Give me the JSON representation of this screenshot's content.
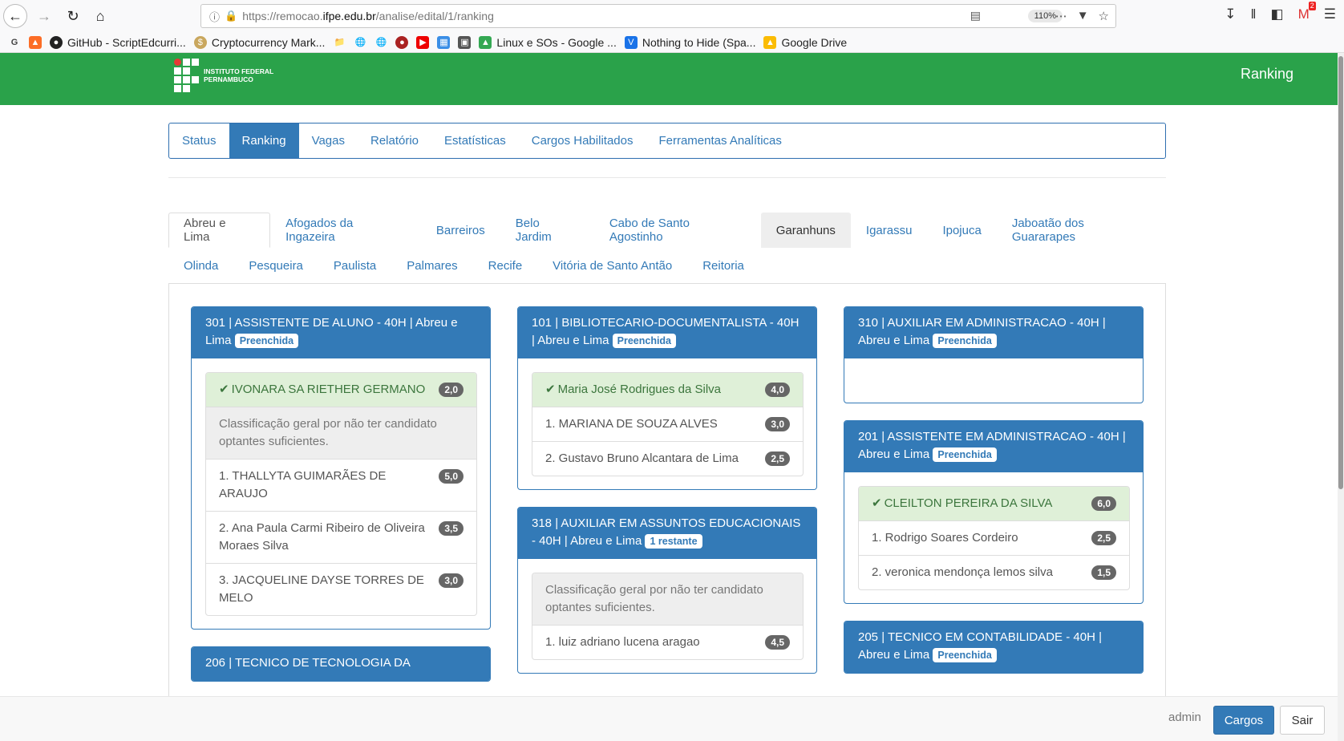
{
  "browser": {
    "url_prefix": "https://remocao.",
    "url_domain": "ifpe.edu.br",
    "url_path": "/analise/edital/1/ranking",
    "zoom": "110%",
    "notification_count": "2"
  },
  "bookmarks": [
    {
      "label": "GitHub - ScriptEdcurri..."
    },
    {
      "label": "Cryptocurrency Mark..."
    },
    {
      "label": "Linux e SOs - Google ..."
    },
    {
      "label": "Nothing to Hide (Spa..."
    },
    {
      "label": "Google Drive"
    }
  ],
  "header": {
    "logo_line1": "INSTITUTO FEDERAL",
    "logo_line2": "PERNAMBUCO",
    "title": "Ranking"
  },
  "main_nav": [
    "Status",
    "Ranking",
    "Vagas",
    "Relatório",
    "Estatísticas",
    "Cargos Habilitados",
    "Ferramentas Analíticas"
  ],
  "campus_tabs_row1": [
    "Abreu e Lima",
    "Afogados da Ingazeira",
    "Barreiros",
    "Belo Jardim",
    "Cabo de Santo Agostinho",
    "Garanhuns",
    "Igarassu",
    "Ipojuca",
    "Jaboatão dos Guararapes"
  ],
  "campus_tabs_row2": [
    "Olinda",
    "Pesqueira",
    "Paulista",
    "Palmares",
    "Recife",
    "Vitória de Santo Antão",
    "Reitoria"
  ],
  "panels": {
    "p301": {
      "title": "301 | ASSISTENTE DE ALUNO - 40H | Abreu e Lima",
      "badge": "Preenchida",
      "winner": "IVONARA SA RIETHER GERMANO",
      "winner_score": "2,0",
      "note": "Classificação geral por não ter candidato optantes suficientes.",
      "items": [
        {
          "name": "1. THALLYTA GUIMARÃES DE ARAUJO",
          "score": "5,0"
        },
        {
          "name": "2. Ana Paula Carmi Ribeiro de Oliveira Moraes Silva",
          "score": "3,5"
        },
        {
          "name": "3. JACQUELINE DAYSE TORRES DE MELO",
          "score": "3,0"
        }
      ]
    },
    "p206": {
      "title": "206 | TECNICO DE TECNOLOGIA DA"
    },
    "p101": {
      "title": "101 | BIBLIOTECARIO-DOCUMENTALISTA - 40H | Abreu e Lima",
      "badge": "Preenchida",
      "winner": "Maria José Rodrigues da Silva",
      "winner_score": "4,0",
      "items": [
        {
          "name": "1. MARIANA DE SOUZA ALVES",
          "score": "3,0"
        },
        {
          "name": "2. Gustavo Bruno Alcantara de Lima",
          "score": "2,5"
        }
      ]
    },
    "p318": {
      "title": "318 | AUXILIAR EM ASSUNTOS EDUCACIONAIS - 40H | Abreu e Lima",
      "badge": "1 restante",
      "note": "Classificação geral por não ter candidato optantes suficientes.",
      "items": [
        {
          "name": "1. luiz adriano lucena aragao",
          "score": "4,5"
        }
      ]
    },
    "p310": {
      "title": "310 | AUXILIAR EM ADMINISTRACAO - 40H | Abreu e Lima",
      "badge": "Preenchida"
    },
    "p201": {
      "title": "201 | ASSISTENTE EM ADMINISTRACAO - 40H | Abreu e Lima",
      "badge": "Preenchida",
      "winner": "CLEILTON PEREIRA DA SILVA",
      "winner_score": "6,0",
      "items": [
        {
          "name": "1. Rodrigo Soares Cordeiro",
          "score": "2,5"
        },
        {
          "name": "2. veronica mendonça lemos silva",
          "score": "1,5"
        }
      ]
    },
    "p205": {
      "title": "205 | TECNICO EM CONTABILIDADE - 40H | Abreu e Lima",
      "badge": "Preenchida"
    }
  },
  "footer": {
    "user": "admin",
    "cargos_button": "Cargos",
    "sair_button": "Sair"
  }
}
